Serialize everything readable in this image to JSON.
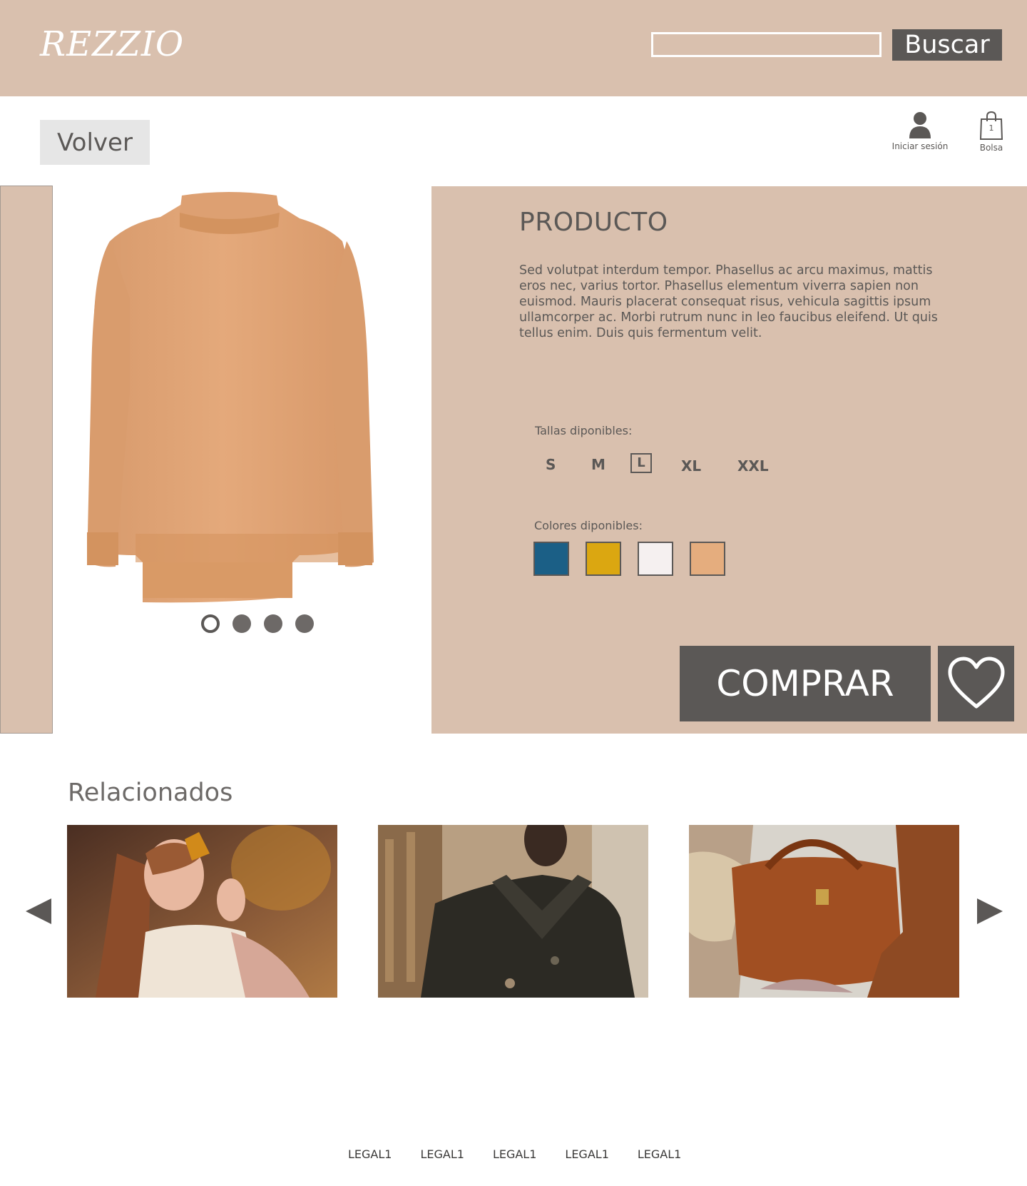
{
  "header": {
    "logo": "REZZIO",
    "search_placeholder": "",
    "search_label": "Buscar"
  },
  "subbar": {
    "back_label": "Volver",
    "login_label": "Iniciar sesión",
    "bag_label": "Bolsa",
    "bag_count": "1"
  },
  "gallery": {
    "dots": [
      {
        "active": true
      },
      {
        "active": false
      },
      {
        "active": false
      },
      {
        "active": false
      }
    ]
  },
  "product": {
    "title": "PRODUCTO",
    "description": "Sed volutpat interdum tempor. Phasellus ac arcu maximus, mattis eros nec, varius tortor. Phasellus elementum viverra sapien non euismod. Mauris placerat consequat risus, vehicula sagittis ipsum ullamcorper ac. Morbi rutrum nunc in leo faucibus eleifend. Ut quis tellus enim. Duis quis fermentum velit.",
    "sizes_label": "Tallas diponibles:",
    "sizes": [
      "S",
      "M",
      "L",
      "XL",
      "XXL"
    ],
    "selected_size": "L",
    "colors_label": "Colores diponibles:",
    "colors": [
      "#1b5f86",
      "#dba711",
      "#f5f0f0",
      "#e5ad7e"
    ],
    "buy_label": "COMPRAR"
  },
  "related": {
    "title": "Relacionados"
  },
  "footer": {
    "links": [
      "LEGAL1",
      "LEGAL1",
      "LEGAL1",
      "LEGAL1",
      "LEGAL1"
    ]
  },
  "theme": {
    "panel": "#d9c0ae",
    "dark": "#5b5856"
  }
}
